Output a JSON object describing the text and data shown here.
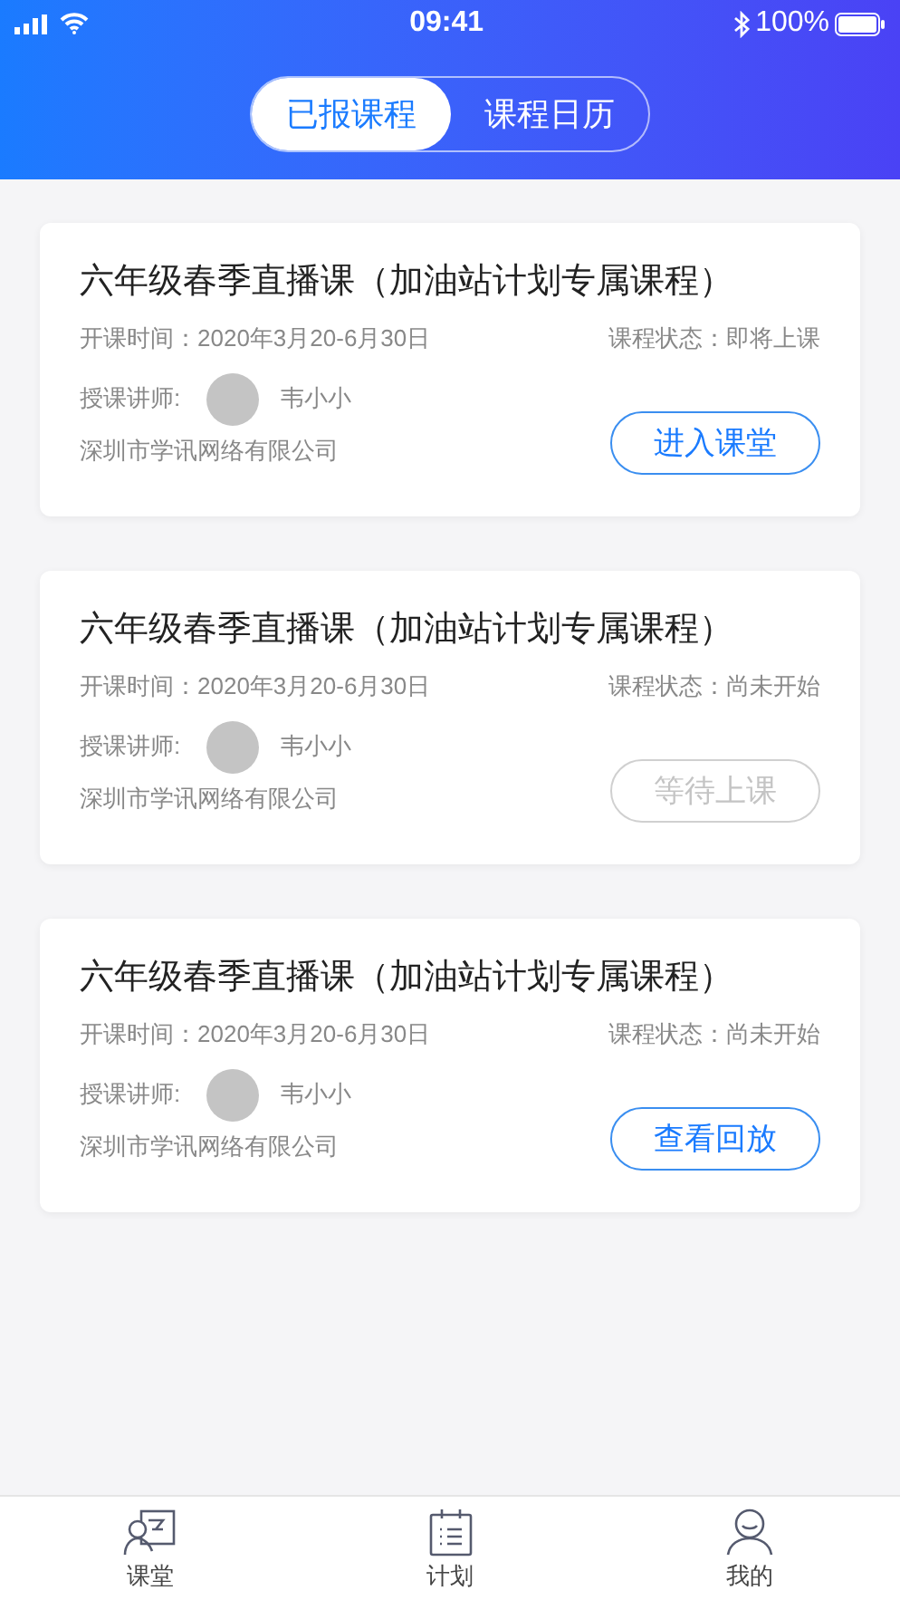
{
  "status_bar": {
    "time": "09:41",
    "battery": "100%"
  },
  "tabs": [
    {
      "label": "已报课程",
      "selected": true
    },
    {
      "label": "课程日历",
      "selected": false
    }
  ],
  "courses": [
    {
      "title": "六年级春季直播课（加油站计划专属课程）",
      "time": "开课时间：2020年3月20-6月30日",
      "status": "课程状态：即将上课",
      "teacher_label": "授课讲师:",
      "teacher": "韦小小",
      "company": "深圳市学讯网络有限公司",
      "button": {
        "label": "进入课堂",
        "disabled": false
      }
    },
    {
      "title": "六年级春季直播课（加油站计划专属课程）",
      "time": "开课时间：2020年3月20-6月30日",
      "status": "课程状态：尚未开始",
      "teacher_label": "授课讲师:",
      "teacher": "韦小小",
      "company": "深圳市学讯网络有限公司",
      "button": {
        "label": "等待上课",
        "disabled": true
      }
    },
    {
      "title": "六年级春季直播课（加油站计划专属课程）",
      "time": "开课时间：2020年3月20-6月30日",
      "status": "课程状态：尚未开始",
      "teacher_label": "授课讲师:",
      "teacher": "韦小小",
      "company": "深圳市学讯网络有限公司",
      "button": {
        "label": "查看回放",
        "disabled": false
      }
    }
  ],
  "bottom_nav": [
    {
      "label": "课堂",
      "kind": "classroom"
    },
    {
      "label": "计划",
      "kind": "plan"
    },
    {
      "label": "我的",
      "kind": "profile"
    }
  ]
}
